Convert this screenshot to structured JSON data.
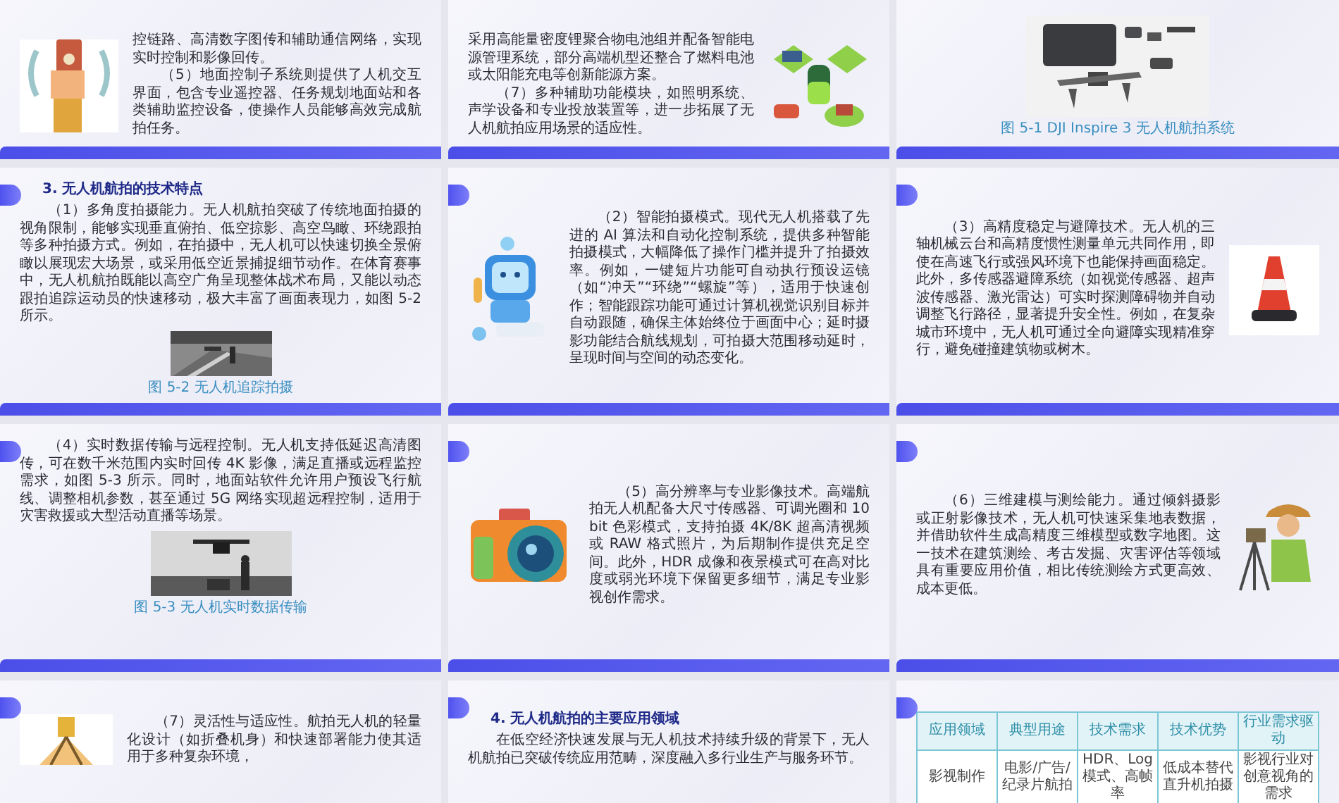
{
  "slides": [
    {
      "kind": "art_left",
      "paragraphs": [
        "控链路、高清数字图传和辅助通信网络，实现实时控制和影像回传。",
        "（5）地面控制子系统则提供了人机交互界面，包含专业遥控器、任务规划地面站和各类辅助监控设备，使操作人员能够高效完成航拍任务。"
      ]
    },
    {
      "kind": "art_right",
      "paragraphs": [
        "采用高能量密度锂聚合物电池组并配备智能电源管理系统，部分高端机型还整合了燃料电池或太阳能充电等创新能源方案。",
        "（7）多种辅助功能模块，如照明系统、声学设备和专业投放装置等，进一步拓展了无人机航拍应用场景的适应性。"
      ]
    },
    {
      "kind": "figure",
      "caption": "图 5-1 DJI Inspire 3 无人机航拍系统"
    },
    {
      "kind": "figure",
      "heading": "3. 无人机航拍的技术特点",
      "paragraphs": [
        "（1）多角度拍摄能力。无人机航拍突破了传统地面拍摄的视角限制，能够实现垂直俯拍、低空掠影、高空鸟瞰、环绕跟拍等多种拍摄方式。例如，在拍摄中，无人机可以快速切换全景俯瞰以展现宏大场景，或采用低空近景捕捉细节动作。在体育赛事中，无人机航拍既能以高空广角呈现整体战术布局，又能以动态跟拍追踪运动员的快速移动，极大丰富了画面表现力，如图 5-2 所示。"
      ],
      "caption": "图 5-2 无人机追踪拍摄"
    },
    {
      "kind": "art_left",
      "paragraphs": [
        "（2）智能拍摄模式。现代无人机搭载了先进的 AI 算法和自动化控制系统，提供多种智能拍摄模式，大幅降低了操作门槛并提升了拍摄效率。例如，一键短片功能可自动执行预设运镜（如“冲天”“环绕”“螺旋”等），适用于快速创作；智能跟踪功能可通过计算机视觉识别目标并自动跟随，确保主体始终位于画面中心；延时摄影功能结合航线规划，可拍摄大范围移动延时，呈现时间与空间的动态变化。"
      ]
    },
    {
      "kind": "art_right",
      "paragraphs": [
        "（3）高精度稳定与避障技术。无人机的三轴机械云台和高精度惯性测量单元共同作用，即使在高速飞行或强风环境下也能保持画面稳定。此外，多传感器避障系统（如视觉传感器、超声波传感器、激光雷达）可实时探测障碍物并自动调整飞行路径，显著提升安全性。例如，在复杂城市环境中，无人机可通过全向避障实现精准穿行，避免碰撞建筑物或树木。"
      ]
    },
    {
      "kind": "figure",
      "paragraphs": [
        "（4）实时数据传输与远程控制。无人机支持低延迟高清图传，可在数千米范围内实时回传 4K 影像，满足直播或远程监控需求，如图 5-3 所示。同时，地面站软件允许用户预设飞行航线、调整相机参数，甚至通过 5G 网络实现超远程控制，适用于灾害救援或大型活动直播等场景。"
      ],
      "caption": "图 5-3 无人机实时数据传输"
    },
    {
      "kind": "art_left",
      "paragraphs": [
        "（5）高分辨率与专业影像技术。高端航拍无人机配备大尺寸传感器、可调光圈和 10 bit 色彩模式，支持拍摄 4K/8K 超高清视频或 RAW 格式照片，为后期制作提供充足空间。此外，HDR 成像和夜景模式可在高对比度或弱光环境下保留更多细节，满足专业影视创作需求。"
      ]
    },
    {
      "kind": "art_right",
      "paragraphs": [
        "（6）三维建模与测绘能力。通过倾斜摄影或正射影像技术，无人机可快速采集地表数据，并借助软件生成高精度三维模型或数字地图。这一技术在建筑测绘、考古发掘、灾害评估等领域具有重要应用价值，相比传统测绘方式更高效、成本更低。"
      ]
    },
    {
      "kind": "art_left",
      "paragraphs": [
        "（7）灵活性与适应性。航拍无人机的轻量化设计（如折叠机身）和快速部署能力使其适用于多种复杂环境，"
      ]
    },
    {
      "kind": "text",
      "heading": "4. 无人机航拍的主要应用领域",
      "paragraphs": [
        "在低空经济快速发展与无人机技术持续升级的背景下，无人机航拍已突破传统应用范畴，深度融入多行业生产与服务环节。"
      ]
    },
    {
      "kind": "table",
      "columns": [
        "应用领域",
        "典型用途",
        "技术需求",
        "技术优势",
        "行业需求驱动"
      ],
      "rows": [
        [
          "影视制作",
          "电影/广告/纪录片航拍",
          "HDR、Log 模式、高帧率",
          "低成本替代直升机拍摄",
          "影视行业对创意视角的需求"
        ]
      ]
    }
  ]
}
